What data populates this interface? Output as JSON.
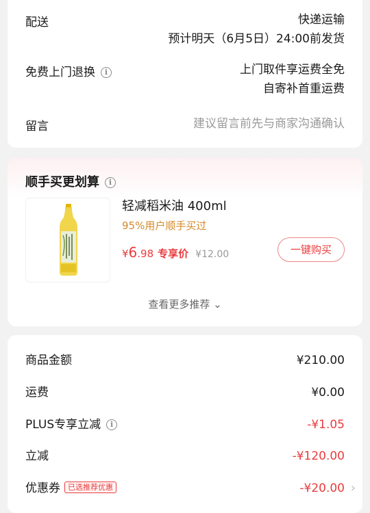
{
  "delivery": {
    "label": "配送",
    "method": "快递运输",
    "eta": "预计明天（6月5日）24:00前发货",
    "return_label": "免费上门退换",
    "return_line1": "上门取件享运费全免",
    "return_line2": "自寄补首重运费",
    "message_label": "留言",
    "message_placeholder": "建议留言前先与商家沟通确认"
  },
  "recommend": {
    "title": "顺手买更划算",
    "product": {
      "name": "轻减稻米油 400ml",
      "subtitle": "95%用户顺手买过",
      "currency": "¥",
      "price_int": "6",
      "price_dec": ".98",
      "price_tag": "专享价",
      "original_price": "¥12.00",
      "image_label": "稻米油",
      "button": "一键购买"
    },
    "more": "查看更多推荐 ⌄"
  },
  "pricing": {
    "rows": [
      {
        "label": "商品金额",
        "value": "¥210.00"
      },
      {
        "label": "运费",
        "value": "¥0.00"
      },
      {
        "label": "PLUS专享立减",
        "value": "-¥1.05"
      },
      {
        "label": "立减",
        "value": "-¥120.00"
      },
      {
        "label": "优惠券",
        "badge": "已选推荐优惠",
        "value": "-¥20.00"
      }
    ]
  },
  "colors": {
    "accent_red": "#e93b3d",
    "accent_orange": "#d68a2a",
    "background": "#f2f2f2"
  },
  "icons": [
    "info-icon",
    "chevron-down-icon",
    "chevron-right-icon"
  ]
}
